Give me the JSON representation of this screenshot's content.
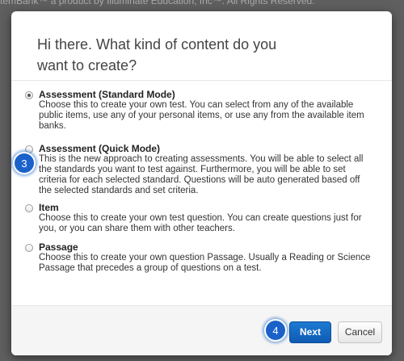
{
  "backdrop": {
    "footer_text": "temBank™ a product by Illuminate Education, Inc™. All Rights Reserved."
  },
  "dialog": {
    "title": "Hi there. What kind of content do you want to create?",
    "options": [
      {
        "title": "Assessment (Standard Mode)",
        "description": "Choose this to create your own test. You can select from any of the available public items, use any of your personal items, or use any from the available item banks.",
        "selected": true
      },
      {
        "title": "Assessment (Quick Mode)",
        "description": "This is the new approach to creating assessments. You will be able to select all the standards you want to test against. Furthermore, you will be able to set criteria for each selected standard. Questions will be auto generated based off the selected standards and set criteria.",
        "selected": false
      },
      {
        "title": "Item",
        "description": "Choose this to create your own test question. You can create questions just for you, or you can share them with other teachers.",
        "selected": false
      },
      {
        "title": "Passage",
        "description": "Choose this to create your own question Passage. Usually a Reading or Science Passage that precedes a group of questions on a test.",
        "selected": false
      }
    ],
    "next_label": "Next",
    "cancel_label": "Cancel"
  },
  "step_badges": [
    "3",
    "4"
  ],
  "colors": {
    "primary_button": "#1a6fc7",
    "step_badge": "#1a62c9",
    "backdrop": "#5f5f5f"
  }
}
